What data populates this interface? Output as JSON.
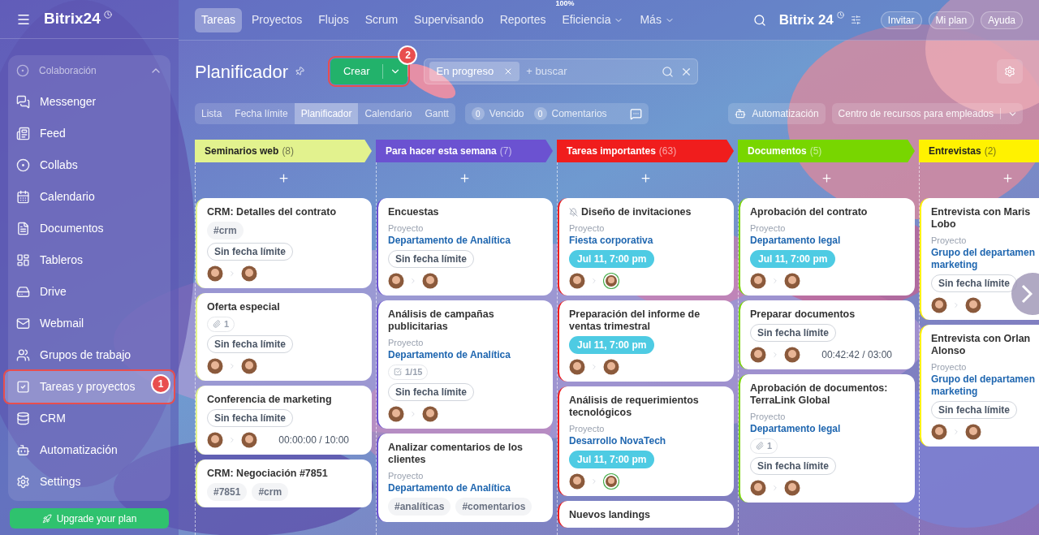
{
  "sidebar": {
    "logo": "Bitrix24",
    "section": {
      "label": "Colaboración",
      "expanded": true
    },
    "items": [
      {
        "label": "Messenger",
        "selected": false
      },
      {
        "label": "Feed",
        "selected": false
      },
      {
        "label": "Collabs",
        "selected": false
      },
      {
        "label": "Calendario",
        "selected": false
      },
      {
        "label": "Documentos",
        "selected": false
      },
      {
        "label": "Tableros",
        "selected": false
      },
      {
        "label": "Drive",
        "selected": false
      },
      {
        "label": "Webmail",
        "selected": false
      },
      {
        "label": "Grupos de trabajo",
        "selected": false
      },
      {
        "label": "Tareas y proyectos",
        "selected": true,
        "callout": "1"
      },
      {
        "label": "CRM",
        "selected": false
      },
      {
        "label": "Automatización",
        "selected": false
      },
      {
        "label": "Settings",
        "selected": false
      }
    ],
    "upgrade_button": "Upgrade your plan"
  },
  "top_nav": {
    "tabs": [
      {
        "label": "Tareas",
        "selected": true
      },
      {
        "label": "Proyectos",
        "selected": false
      },
      {
        "label": "Flujos",
        "selected": false
      },
      {
        "label": "Scrum",
        "selected": false
      },
      {
        "label": "Supervisando",
        "selected": false
      },
      {
        "label": "Reportes",
        "selected": false
      },
      {
        "label": "Eficiencia",
        "selected": false,
        "badge": "100%",
        "dropdown": true
      },
      {
        "label": "Más",
        "selected": false,
        "dropdown": true
      }
    ],
    "logo": "Bitrix 24",
    "buttons": [
      "Invitar",
      "Mi plan",
      "Ayuda"
    ]
  },
  "header": {
    "title": "Planificador",
    "create_button": "Crear",
    "create_callout": "2",
    "search": {
      "chip": "En progreso",
      "placeholder": "+ buscar"
    }
  },
  "views": [
    {
      "label": "Lista",
      "selected": false
    },
    {
      "label": "Fecha límite",
      "selected": false
    },
    {
      "label": "Planificador",
      "selected": true
    },
    {
      "label": "Calendario",
      "selected": false
    },
    {
      "label": "Gantt",
      "selected": false
    }
  ],
  "counters": [
    {
      "count": "0",
      "label": "Vencido"
    },
    {
      "count": "0",
      "label": "Comentarios"
    }
  ],
  "automation_button": "Automatización",
  "resource_dropdown": "Centro de recursos para empleados",
  "columns": [
    {
      "title": "Seminarios web",
      "count": "(8)",
      "color": "#e2f28e",
      "cards": [
        {
          "title": "CRM: Detalles del contrato",
          "muted": false,
          "tags": [
            "#crm"
          ],
          "deadline": {
            "kind": "none",
            "text": "Sin fecha límite"
          },
          "ringed": false
        },
        {
          "title": "Oferta especial",
          "muted": false,
          "counter": {
            "kind": "attachment",
            "text": "1"
          },
          "deadline": {
            "kind": "none",
            "text": "Sin fecha límite"
          },
          "ringed": false
        },
        {
          "title": "Conferencia de marketing",
          "muted": false,
          "deadline": {
            "kind": "none",
            "text": "Sin fecha límite"
          },
          "timer": "00:00:00 / 10:00",
          "ringed": false
        },
        {
          "title": "CRM: Negociación #7851",
          "muted": false,
          "tags": [
            "#7851",
            "#crm"
          ]
        }
      ]
    },
    {
      "title": "Para hacer esta semana",
      "count": "(7)",
      "color": "#6b52d1",
      "cards": [
        {
          "title": "Encuestas",
          "muted": false,
          "project_label": "Proyecto",
          "project": "Departamento de Analítica",
          "deadline": {
            "kind": "none",
            "text": "Sin fecha límite"
          },
          "ringed": false
        },
        {
          "title": "Análisis de campañas publicitarias",
          "muted": false,
          "project_label": "Proyecto",
          "project": "Departamento de Analítica",
          "counter": {
            "kind": "checklist",
            "text": "1/15"
          },
          "deadline": {
            "kind": "none",
            "text": "Sin fecha límite"
          },
          "ringed": false
        },
        {
          "title": "Analizar comentarios de los clientes",
          "muted": false,
          "project_label": "Proyecto",
          "project": "Departamento de Analítica",
          "tags": [
            "#analíticas",
            "#comentarios"
          ]
        }
      ]
    },
    {
      "title": "Tareas importantes",
      "count": "(63)",
      "color": "#f01d1d",
      "cards": [
        {
          "title": "Diseño de invitaciones",
          "muted": true,
          "project_label": "Proyecto",
          "project": "Fiesta corporativa",
          "deadline": {
            "kind": "date",
            "text": "Jul 11, 7:00 pm"
          },
          "ringed": true
        },
        {
          "title": "Preparación del informe de ventas trimestral",
          "muted": false,
          "deadline": {
            "kind": "date",
            "text": "Jul 11, 7:00 pm"
          },
          "ringed": false
        },
        {
          "title": "Análisis de requerimientos tecnológicos",
          "muted": false,
          "project_label": "Proyecto",
          "project": "Desarrollo NovaTech",
          "deadline": {
            "kind": "date",
            "text": "Jul 11, 7:00 pm"
          },
          "ringed": true
        },
        {
          "title": "Nuevos landings",
          "muted": false
        }
      ]
    },
    {
      "title": "Documentos",
      "count": "(5)",
      "color": "#78d600",
      "cards": [
        {
          "title": "Aprobación del contrato",
          "muted": false,
          "project_label": "Proyecto",
          "project": "Departamento legal",
          "deadline": {
            "kind": "date",
            "text": "Jul 11, 7:00 pm"
          },
          "ringed": false
        },
        {
          "title": "Preparar documentos",
          "muted": false,
          "deadline": {
            "kind": "none",
            "text": "Sin fecha límite"
          },
          "timer": "00:42:42 / 03:00",
          "ringed": false
        },
        {
          "title": "Aprobación de documentos: TerraLink Global",
          "muted": false,
          "project_label": "Proyecto",
          "project": "Departamento legal",
          "counter": {
            "kind": "attachment",
            "text": "1"
          },
          "deadline": {
            "kind": "none",
            "text": "Sin fecha límite"
          },
          "ringed": false
        }
      ]
    },
    {
      "title": "Entrevistas",
      "count": "(2)",
      "color": "#fff200",
      "cards": [
        {
          "title": "Entrevista con Maris Lobo",
          "muted": false,
          "project_label": "Proyecto",
          "project": "Grupo del departamen marketing",
          "deadline": {
            "kind": "none",
            "text": "Sin fecha límite"
          },
          "ringed": false
        },
        {
          "title": "Entrevista con Orlan Alonso",
          "muted": false,
          "project_label": "Proyecto",
          "project": "Grupo del departamen marketing",
          "deadline": {
            "kind": "none",
            "text": "Sin fecha límite"
          },
          "ringed": false
        }
      ]
    }
  ]
}
